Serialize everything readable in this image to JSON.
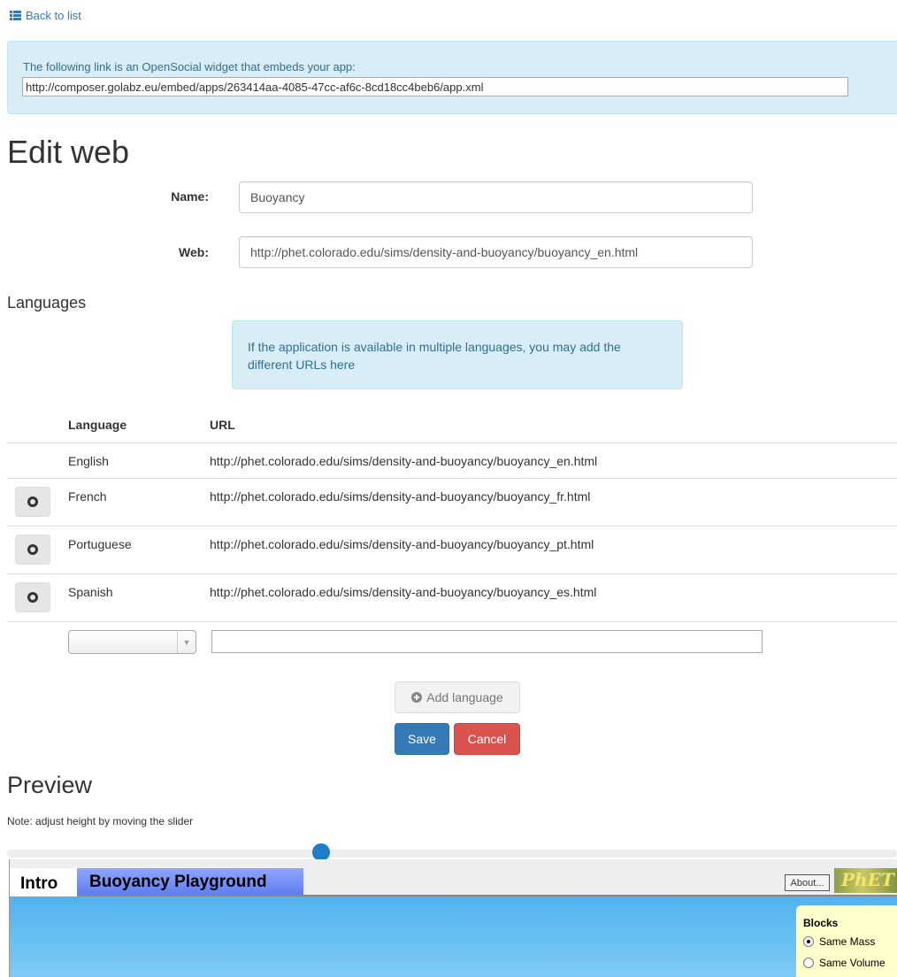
{
  "nav": {
    "back_label": "Back to list"
  },
  "widget": {
    "text": "The following link is an OpenSocial widget that embeds your app:",
    "url": "http://composer.golabz.eu/embed/apps/263414aa-4085-47cc-af6c-8cd18cc4beb6/app.xml"
  },
  "page_title": "Edit web",
  "form": {
    "name_label": "Name:",
    "name_value": "Buoyancy",
    "web_label": "Web:",
    "web_value": "http://phet.colorado.edu/sims/density-and-buoyancy/buoyancy_en.html"
  },
  "languages": {
    "heading": "Languages",
    "info": "If the application is available in multiple languages, you may add the different URLs here",
    "col_language": "Language",
    "col_url": "URL",
    "rows": [
      {
        "language": "English",
        "url": "http://phet.colorado.edu/sims/density-and-buoyancy/buoyancy_en.html"
      },
      {
        "language": "French",
        "url": "http://phet.colorado.edu/sims/density-and-buoyancy/buoyancy_fr.html"
      },
      {
        "language": "Portuguese",
        "url": "http://phet.colorado.edu/sims/density-and-buoyancy/buoyancy_pt.html"
      },
      {
        "language": "Spanish",
        "url": "http://phet.colorado.edu/sims/density-and-buoyancy/buoyancy_es.html"
      }
    ],
    "new_language_value": "",
    "new_url_value": ""
  },
  "buttons": {
    "add_language": "Add language",
    "save": "Save",
    "cancel": "Cancel"
  },
  "preview": {
    "heading": "Preview",
    "note": "Note: adjust height by moving the slider"
  },
  "embed": {
    "tab_intro": "Intro",
    "tab_playground": "Buoyancy Playground",
    "about": "About...",
    "logo_text": "PhET",
    "blocks_title": "Blocks",
    "option_same_mass": "Same Mass",
    "option_same_volume": "Same Volume"
  }
}
